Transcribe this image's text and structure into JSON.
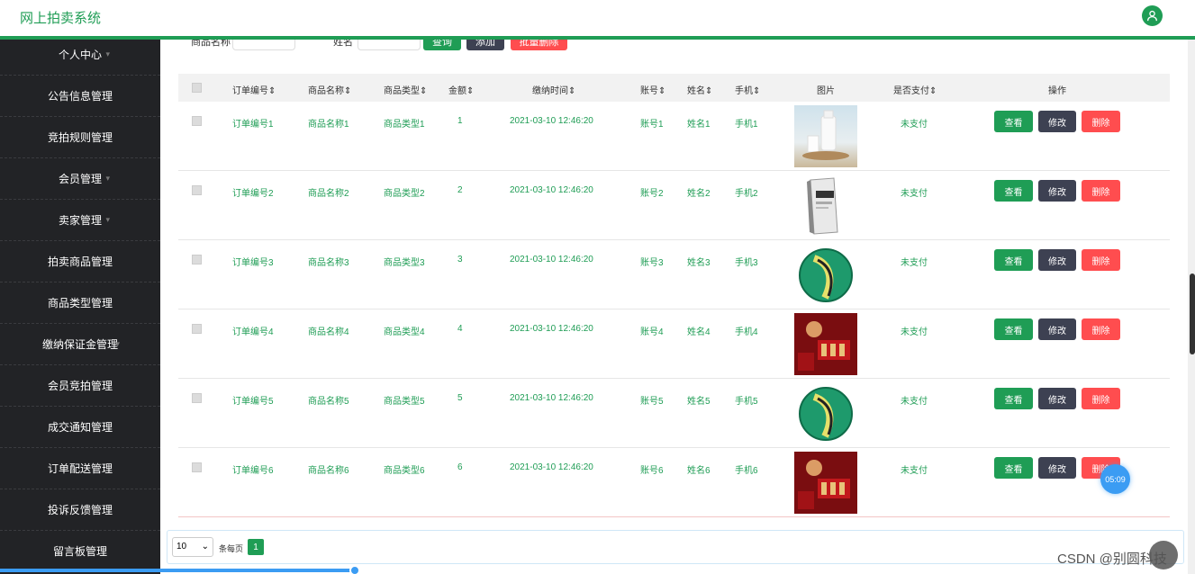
{
  "app": {
    "title": "网上拍卖系统"
  },
  "sidebar": {
    "items": [
      {
        "label": "个人中心"
      },
      {
        "label": "公告信息管理"
      },
      {
        "label": "竞拍规则管理"
      },
      {
        "label": "会员管理"
      },
      {
        "label": "卖家管理"
      },
      {
        "label": "拍卖商品管理"
      },
      {
        "label": "商品类型管理"
      },
      {
        "label": "缴纳保证金管理"
      },
      {
        "label": "会员竞拍管理"
      },
      {
        "label": "成交通知管理"
      },
      {
        "label": "订单配送管理"
      },
      {
        "label": "投诉反馈管理"
      },
      {
        "label": "留言板管理"
      }
    ]
  },
  "search": {
    "label1": "商品名称",
    "label2": "姓名",
    "query_label": "查询",
    "add_label": "添加",
    "batch_delete_label": "批量删除"
  },
  "table": {
    "headers": {
      "order_no": "订单编号",
      "product_name": "商品名称",
      "product_type": "商品类型",
      "amount": "金额",
      "pay_time": "缴纳时间",
      "account": "账号",
      "name": "姓名",
      "phone": "手机",
      "image": "图片",
      "paid": "是否支付",
      "actions": "操作"
    },
    "rows": [
      {
        "order_no": "订单编号1",
        "product_name": "商品名称1",
        "product_type": "商品类型1",
        "amount": "1",
        "pay_time": "2021-03-10 12:46:20",
        "account": "账号1",
        "name": "姓名1",
        "phone": "手机1",
        "image": "milk",
        "paid": "未支付"
      },
      {
        "order_no": "订单编号2",
        "product_name": "商品名称2",
        "product_type": "商品类型2",
        "amount": "2",
        "pay_time": "2021-03-10 12:46:20",
        "account": "账号2",
        "name": "姓名2",
        "phone": "手机2",
        "image": "book",
        "paid": "未支付"
      },
      {
        "order_no": "订单编号3",
        "product_name": "商品名称3",
        "product_type": "商品类型3",
        "amount": "3",
        "pay_time": "2021-03-10 12:46:20",
        "account": "账号3",
        "name": "姓名3",
        "phone": "手机3",
        "image": "ball",
        "paid": "未支付"
      },
      {
        "order_no": "订单编号4",
        "product_name": "商品名称4",
        "product_type": "商品类型4",
        "amount": "4",
        "pay_time": "2021-03-10 12:46:20",
        "account": "账号4",
        "name": "姓名4",
        "phone": "手机4",
        "image": "redbox",
        "paid": "未支付"
      },
      {
        "order_no": "订单编号5",
        "product_name": "商品名称5",
        "product_type": "商品类型5",
        "amount": "5",
        "pay_time": "2021-03-10 12:46:20",
        "account": "账号5",
        "name": "姓名5",
        "phone": "手机5",
        "image": "ball",
        "paid": "未支付"
      },
      {
        "order_no": "订单编号6",
        "product_name": "商品名称6",
        "product_type": "商品类型6",
        "amount": "6",
        "pay_time": "2021-03-10 12:46:20",
        "account": "账号6",
        "name": "姓名6",
        "phone": "手机6",
        "image": "redbox",
        "paid": "未支付"
      }
    ],
    "buttons": {
      "view": "查看",
      "edit": "修改",
      "delete": "删除"
    },
    "sort_glyph": "⇕"
  },
  "pager": {
    "page_size": "10",
    "per_page_label": "条每页",
    "current_page": "1"
  },
  "overlay": {
    "timer": "05:09",
    "watermark": "CSDN @别圆科技"
  },
  "colors": {
    "brand": "#1f9d55",
    "sidebar": "#222326",
    "danger": "#ff4d4f",
    "neutral": "#3d4152"
  }
}
